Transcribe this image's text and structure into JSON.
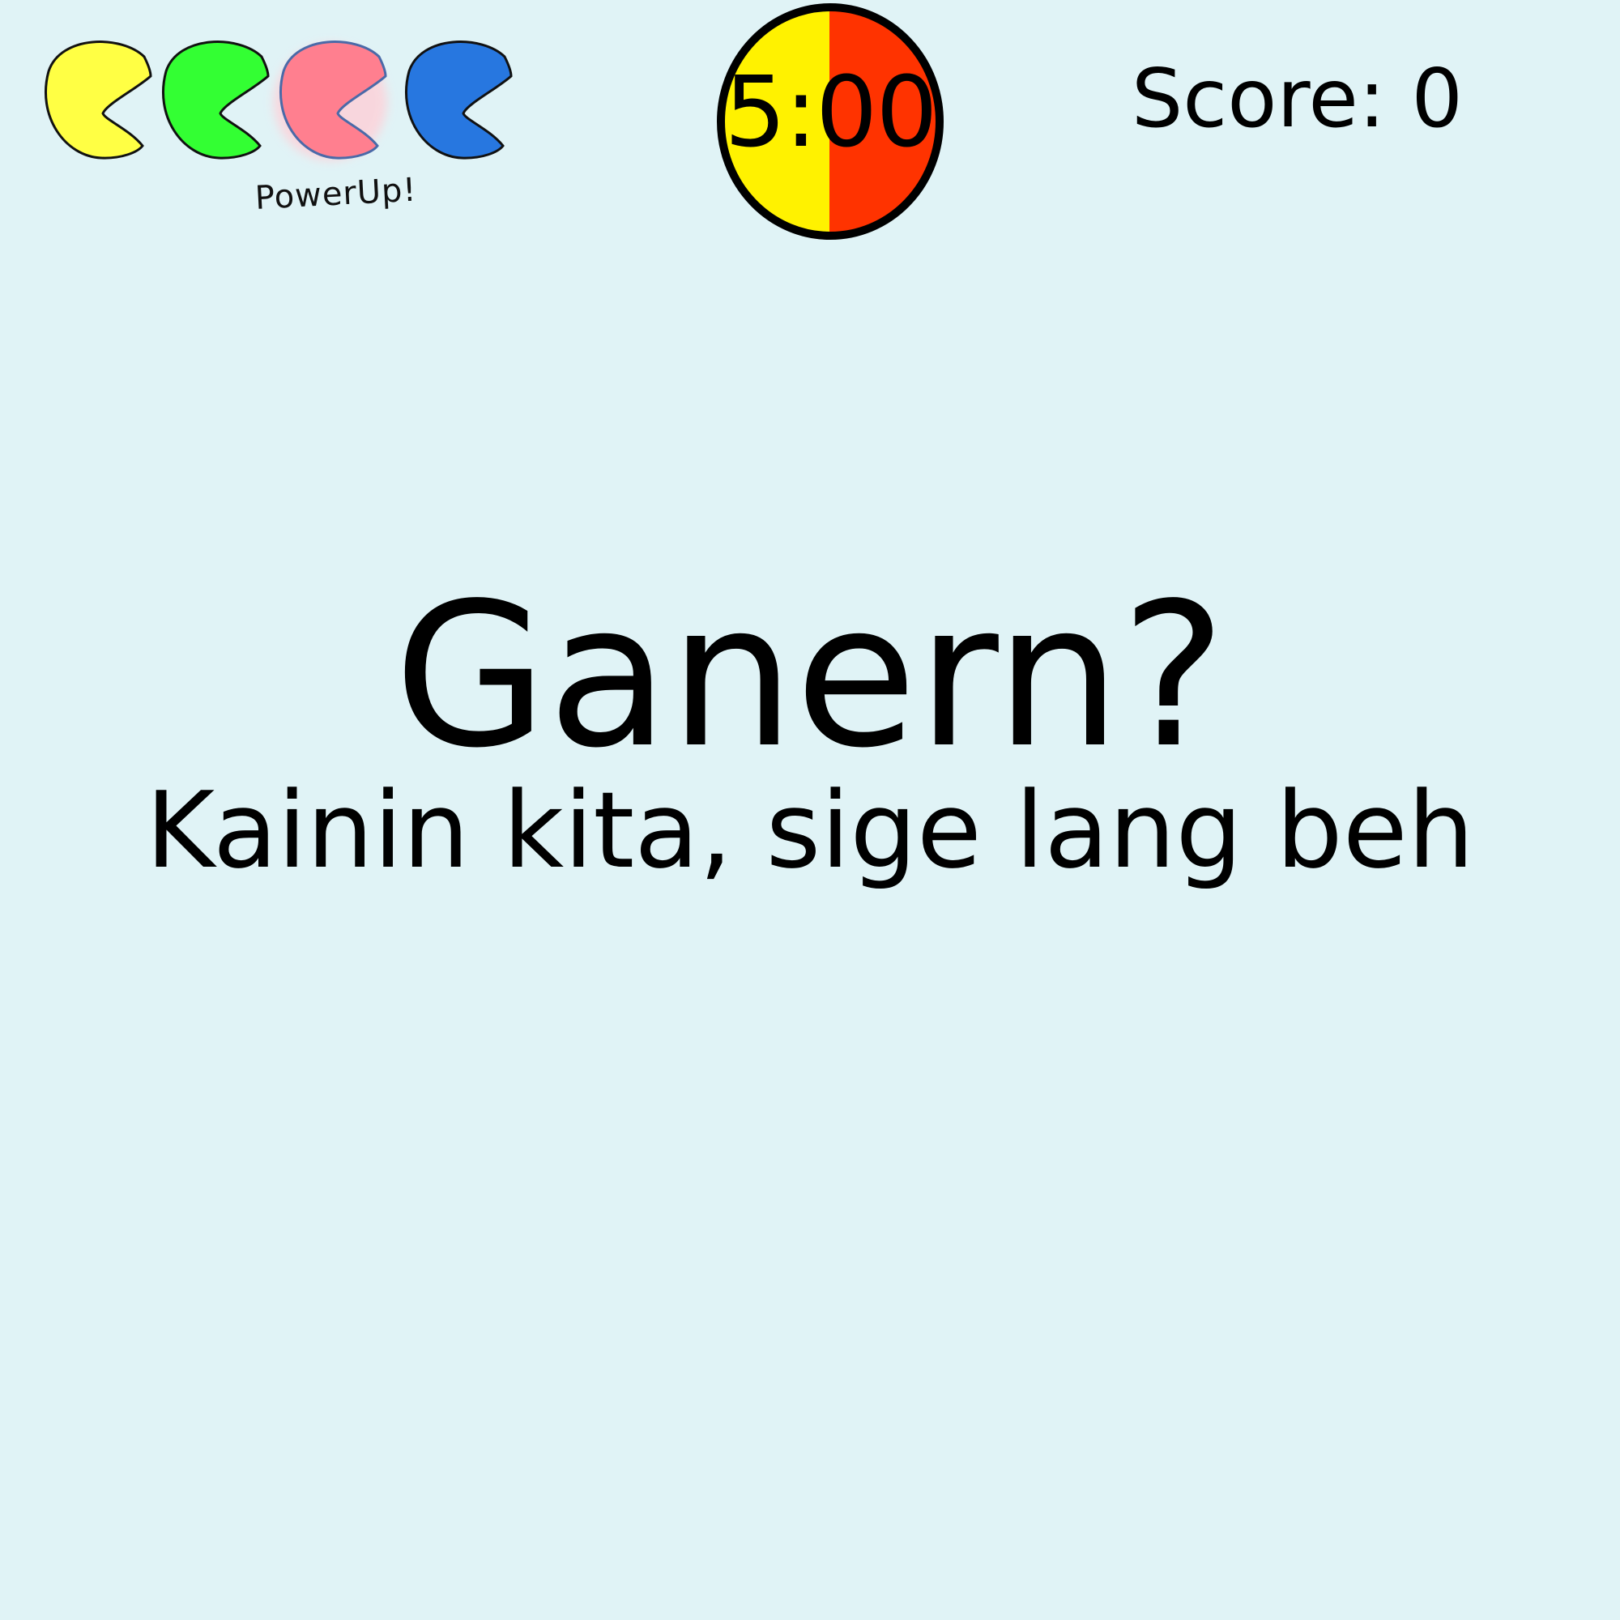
{
  "hud": {
    "lives": [
      {
        "color": "#ffff44",
        "name": "yellow"
      },
      {
        "color": "#33ff33",
        "name": "green"
      },
      {
        "color": "#ff7f8f",
        "name": "pink",
        "powered": true
      },
      {
        "color": "#2777e0",
        "name": "blue"
      }
    ],
    "powerup_label": "PowerUp!",
    "timer": {
      "text": "5:00",
      "left_color": "#fff200",
      "right_color": "#ff3300"
    },
    "score": "Score: 0"
  },
  "main": {
    "question": "Ganern?",
    "subtitle": "Kainin kita, sige lang beh"
  }
}
